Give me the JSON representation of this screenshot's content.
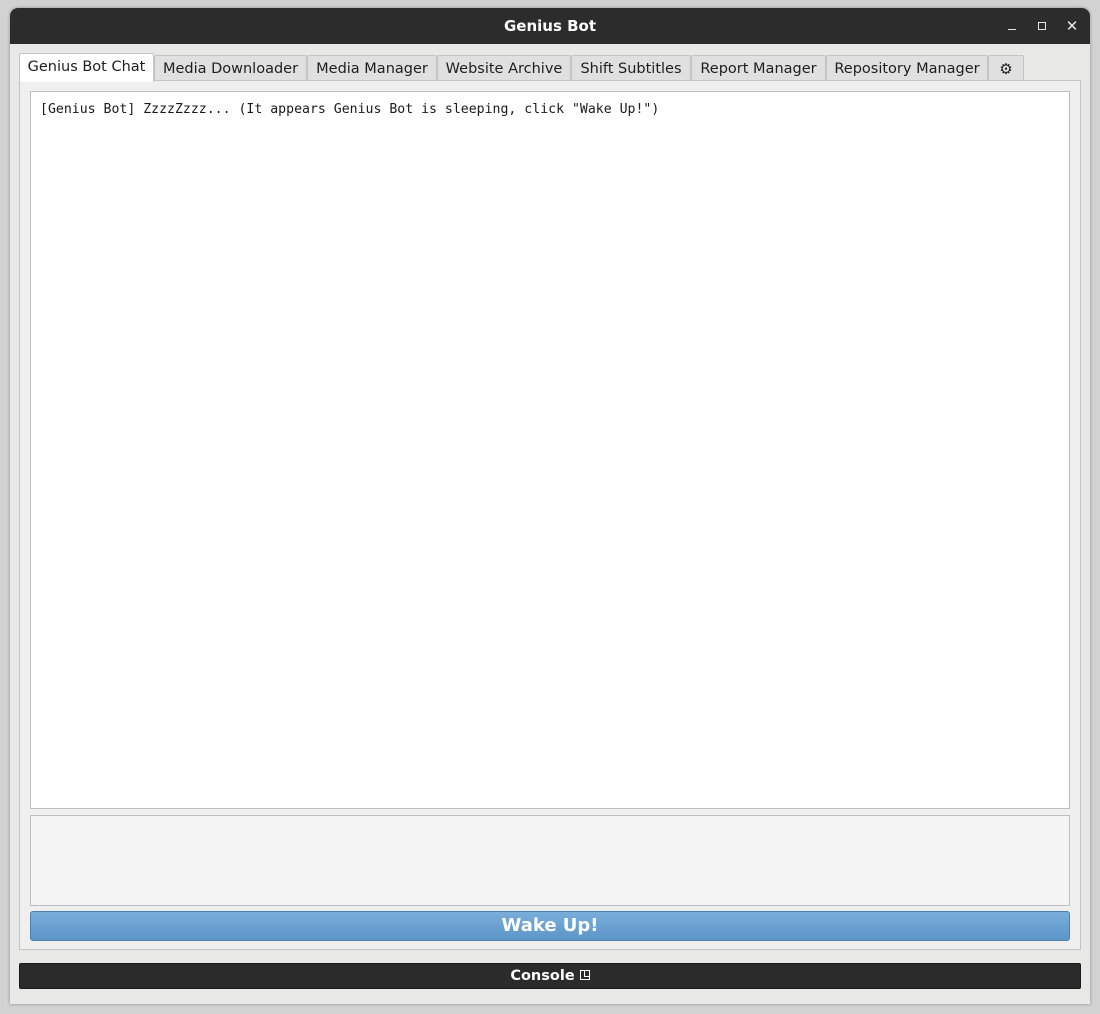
{
  "window": {
    "title": "Genius Bot",
    "controls": {
      "minimize": "minimize-icon",
      "maximize": "maximize-icon",
      "close": "close-icon",
      "close_glyph": "✕"
    }
  },
  "tabs": [
    {
      "label": "Genius Bot Chat",
      "active": true
    },
    {
      "label": "Media Downloader",
      "active": false
    },
    {
      "label": "Media Manager",
      "active": false
    },
    {
      "label": "Website Archive",
      "active": false
    },
    {
      "label": "Shift Subtitles",
      "active": false
    },
    {
      "label": "Report Manager",
      "active": false
    },
    {
      "label": "Repository Manager",
      "active": false
    },
    {
      "label": "⚙",
      "icon": "gear-icon",
      "active": false
    }
  ],
  "chat": {
    "log": "[Genius Bot] ZzzzZzzz... (It appears Genius Bot is sleeping, click \"Wake Up!\")",
    "input_value": ""
  },
  "wake_button": {
    "label": "Wake Up!",
    "color": "#6aa2d3"
  },
  "console": {
    "label": "Console",
    "icon": "dock-icon"
  },
  "colors": {
    "titlebar": "#2c2c2c",
    "console_bar": "#2b2b2b",
    "accent": "#6aa2d3"
  }
}
